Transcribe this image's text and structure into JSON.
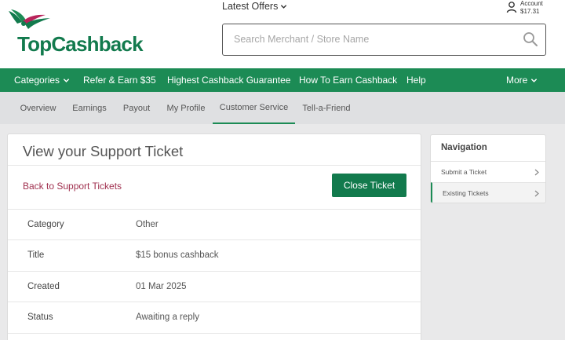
{
  "brand": {
    "logo_text": "TopCashback",
    "green": "#127a4d",
    "accent": "#a0304f"
  },
  "header": {
    "latest_offers": "Latest Offers",
    "account_label": "Account",
    "account_balance": "$17.31",
    "search_placeholder": "Search Merchant / Store Name"
  },
  "main_nav": [
    {
      "label": "Categories",
      "dropdown": true
    },
    {
      "label": "Refer & Earn $35"
    },
    {
      "label": "Highest Cashback Guarantee"
    },
    {
      "label": "How To Earn Cashback"
    },
    {
      "label": "Help"
    },
    {
      "label": "More",
      "dropdown": true
    }
  ],
  "sub_nav": [
    {
      "label": "Overview"
    },
    {
      "label": "Earnings"
    },
    {
      "label": "Payout"
    },
    {
      "label": "My Profile"
    },
    {
      "label": "Customer Service",
      "active": true
    },
    {
      "label": "Tell-a-Friend"
    }
  ],
  "ticket": {
    "title": "View your Support Ticket",
    "back_link": "Back to Support Tickets",
    "close_button": "Close Ticket",
    "rows": [
      {
        "label": "Category",
        "value": "Other"
      },
      {
        "label": "Title",
        "value": "$15 bonus cashback"
      },
      {
        "label": "Created",
        "value": "01 Mar 2025"
      },
      {
        "label": "Status",
        "value": "Awaiting a reply"
      }
    ]
  },
  "sidebar": {
    "title": "Navigation",
    "items": [
      {
        "label": "Submit a Ticket"
      },
      {
        "label": "Existing Tickets",
        "active": true
      }
    ]
  }
}
